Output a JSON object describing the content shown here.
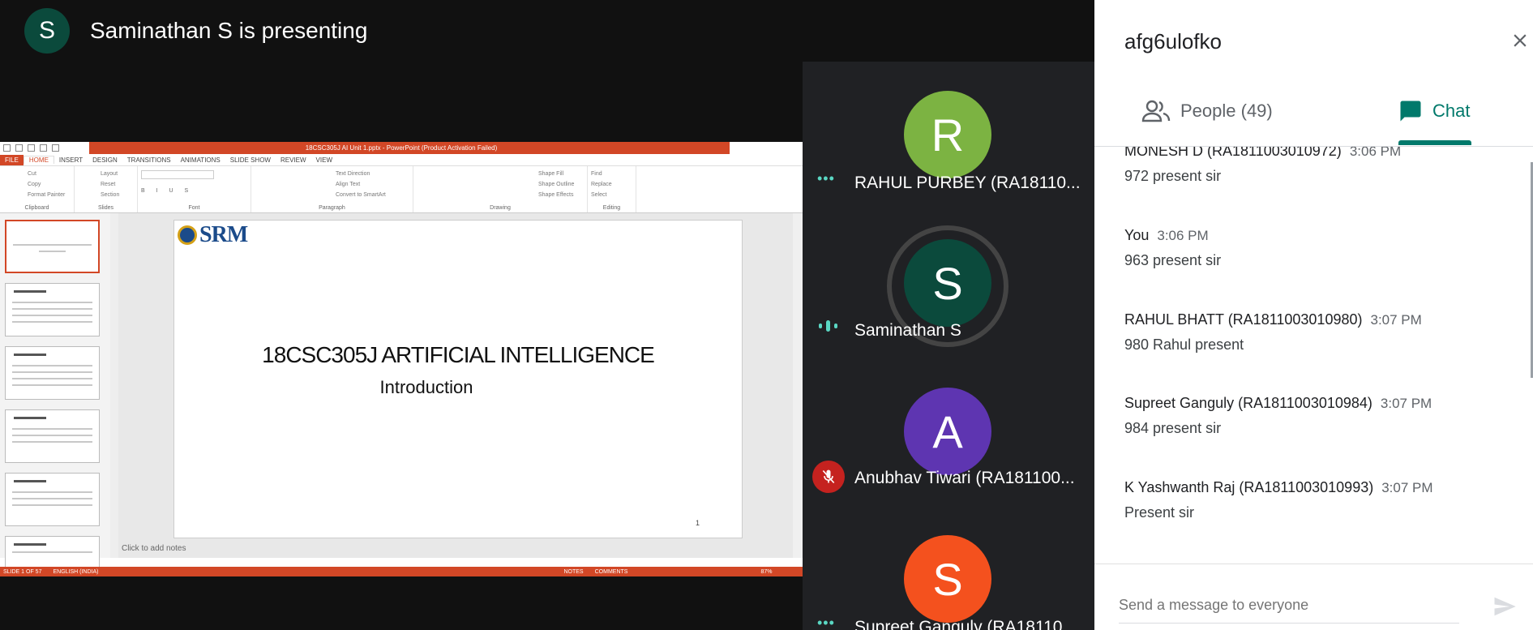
{
  "presenter": {
    "initial": "S",
    "text": "Saminathan S is presenting",
    "avatar_color": "#0b4a3c"
  },
  "powerpoint": {
    "title": "18CSC305J AI Unit 1.pptx - PowerPoint (Product Activation Failed)",
    "tabs": [
      "FILE",
      "HOME",
      "INSERT",
      "DESIGN",
      "TRANSITIONS",
      "ANIMATIONS",
      "SLIDE SHOW",
      "REVIEW",
      "VIEW"
    ],
    "active_tab": "HOME",
    "ribbon_groups": [
      "Clipboard",
      "Slides",
      "Font",
      "Paragraph",
      "Drawing",
      "Editing"
    ],
    "clipboard_items": [
      "Cut",
      "Copy",
      "Format Painter"
    ],
    "slides_items": [
      "Layout",
      "Reset",
      "Section"
    ],
    "new_slide": "New Slide",
    "paragraph_items": [
      "Text Direction",
      "Align Text",
      "Convert to SmartArt"
    ],
    "drawing_items": [
      "Shape Fill",
      "Shape Outline",
      "Shape Effects"
    ],
    "arrange": "Arrange",
    "quick_styles": "Quick Styles",
    "editing_items": [
      "Find",
      "Replace",
      "Select"
    ],
    "slide_logo": "SRM",
    "slide_title": "18CSC305J ARTIFICIAL INTELLIGENCE",
    "slide_subtitle": "Introduction",
    "slide_number": "1",
    "notes_placeholder": "Click to add notes",
    "status_slide": "SLIDE 1 OF 57",
    "status_language": "ENGLISH (INDIA)",
    "status_notes": "NOTES",
    "status_comments": "COMMENTS",
    "zoom": "87%",
    "accent": "#d24726"
  },
  "participants": [
    {
      "initial": "R",
      "name": "RAHUL PURBEY (RA18110...",
      "color": "#7cb342",
      "status": "speaking"
    },
    {
      "initial": "S",
      "name": "Saminathan S",
      "color": "#0b4a3c",
      "status": "speaking"
    },
    {
      "initial": "A",
      "name": "Anubhav Tiwari (RA181100...",
      "color": "#5e35b1",
      "status": "muted"
    },
    {
      "initial": "S",
      "name": "Supreet Ganguly (RA18110...",
      "color": "#f4511e",
      "status": "speaking"
    }
  ],
  "panel": {
    "meeting_code": "afg6ulofko",
    "tab_people": "People (49)",
    "tab_chat": "Chat",
    "active_tab": "Chat",
    "accent": "#00796b",
    "compose_placeholder": "Send a message to everyone"
  },
  "messages": [
    {
      "sender": "MONESH D (RA1811003010972)",
      "time": "3:06 PM",
      "text": "972 present sir"
    },
    {
      "sender": "You",
      "time": "3:06 PM",
      "text": "963 present sir"
    },
    {
      "sender": "RAHUL BHATT (RA1811003010980)",
      "time": "3:07 PM",
      "text": "980 Rahul present"
    },
    {
      "sender": "Supreet Ganguly (RA1811003010984)",
      "time": "3:07 PM",
      "text": "984 present sir"
    },
    {
      "sender": "K Yashwanth Raj (RA1811003010993)",
      "time": "3:07 PM",
      "text": "Present sir"
    }
  ]
}
